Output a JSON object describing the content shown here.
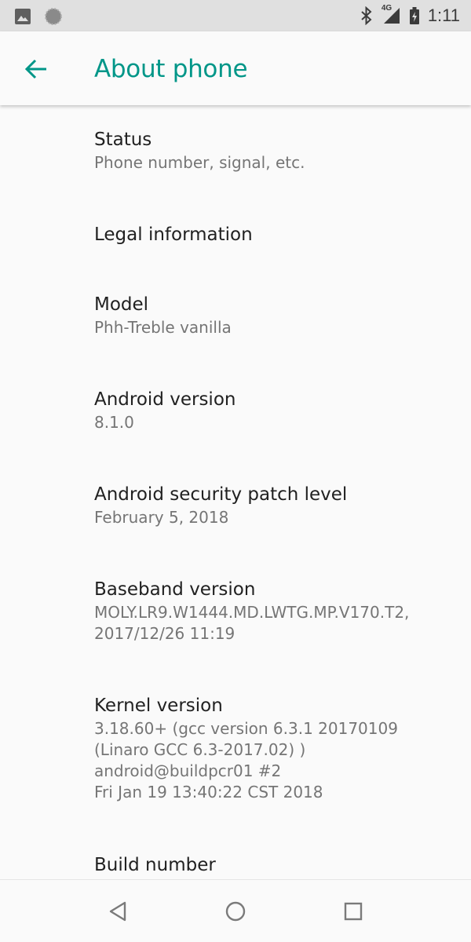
{
  "status_bar": {
    "time": "1:11",
    "network": "4G",
    "icons": [
      "image-notification-icon",
      "circle-notification-icon",
      "bluetooth-icon",
      "signal-icon",
      "battery-icon"
    ]
  },
  "app_bar": {
    "title": "About phone",
    "back_icon": "arrow-back-icon",
    "accent_color": "#009688"
  },
  "items": [
    {
      "title": "Status",
      "summary": [
        "Phone number, signal, etc."
      ]
    },
    {
      "title": "Legal information",
      "summary": []
    },
    {
      "title": "Model",
      "summary": [
        "Phh-Treble vanilla"
      ]
    },
    {
      "title": "Android version",
      "summary": [
        "8.1.0"
      ]
    },
    {
      "title": "Android security patch level",
      "summary": [
        "February 5, 2018"
      ]
    },
    {
      "title": "Baseband version",
      "summary": [
        "MOLY.LR9.W1444.MD.LWTG.MP.V170.T2,",
        "2017/12/26 11:19"
      ]
    },
    {
      "title": "Kernel version",
      "summary": [
        "3.18.60+ (gcc version 6.3.1 20170109",
        "(Linaro GCC 6.3-2017.02) )",
        "android@buildpcr01 #2",
        "Fri Jan 19 13:40:22 CST 2018"
      ]
    },
    {
      "title": "Build number",
      "summary": []
    }
  ],
  "nav_bar": {
    "buttons": [
      "back-triangle-icon",
      "home-circle-icon",
      "recents-square-icon"
    ]
  }
}
